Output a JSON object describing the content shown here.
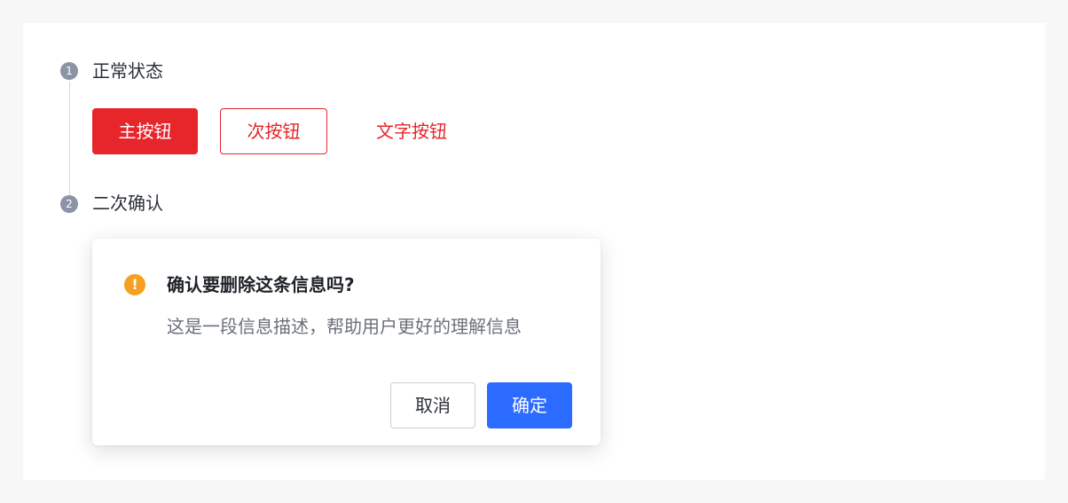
{
  "colors": {
    "danger": "#e6262b",
    "primary_blue": "#2c6bff",
    "warning": "#f5a020",
    "step_dot": "#8c93a4"
  },
  "steps": [
    {
      "number": "1",
      "title": "正常状态"
    },
    {
      "number": "2",
      "title": "二次确认"
    }
  ],
  "buttons": {
    "primary_label": "主按钮",
    "secondary_label": "次按钮",
    "text_label": "文字按钮"
  },
  "confirm_popover": {
    "icon": "exclamation-icon",
    "icon_glyph": "!",
    "title": "确认要删除这条信息吗?",
    "description": "这是一段信息描述，帮助用户更好的理解信息",
    "cancel_label": "取消",
    "ok_label": "确定"
  }
}
